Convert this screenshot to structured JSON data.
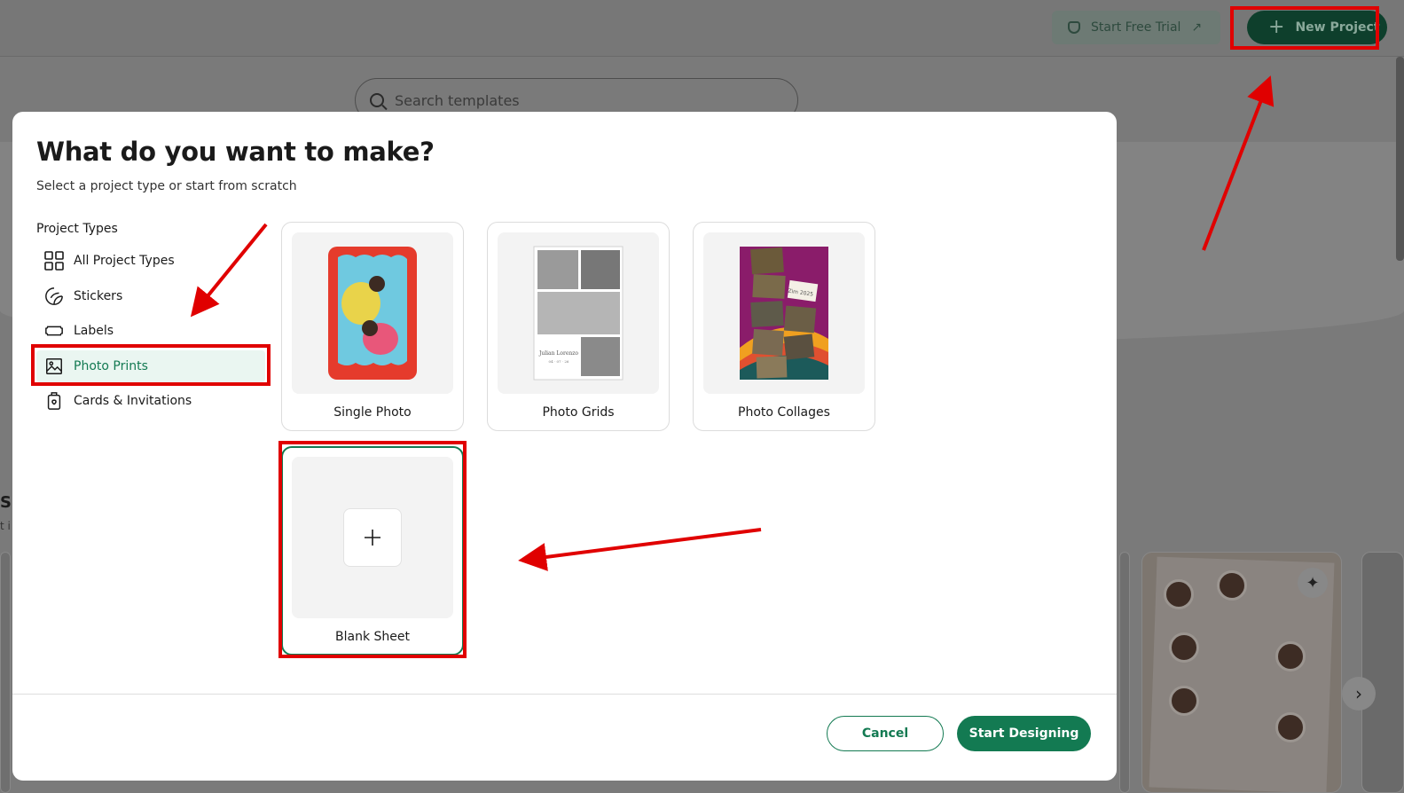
{
  "app": {
    "trial_button_label": "Start Free Trial",
    "trial_button_arrow": "↗",
    "new_project_label": "New Project",
    "search_placeholder": "Search templates",
    "section_heading_fragment": "Sh",
    "section_sub_fragment": "t i"
  },
  "modal": {
    "title": "What do you want to make?",
    "subtitle": "Select a project type or start from scratch",
    "project_types_heading": "Project Types",
    "project_types": [
      {
        "label": "All Project Types",
        "icon": "grid-icon"
      },
      {
        "label": "Stickers",
        "icon": "sticker-icon"
      },
      {
        "label": "Labels",
        "icon": "label-icon"
      },
      {
        "label": "Photo Prints",
        "icon": "image-icon",
        "selected": true
      },
      {
        "label": "Cards & Invitations",
        "icon": "card-icon"
      }
    ],
    "options": [
      {
        "label": "Single Photo"
      },
      {
        "label": "Photo Grids",
        "grid_caption": "Julian Lorenzo"
      },
      {
        "label": "Photo Collages",
        "collage_caption": "Zim 2025"
      },
      {
        "label": "Blank Sheet",
        "selected": true
      }
    ],
    "cancel_label": "Cancel",
    "start_label": "Start Designing"
  },
  "colors": {
    "accent_green": "#137a52",
    "highlight_red": "#e00000",
    "overlay_gray": "#7a7a7a"
  }
}
